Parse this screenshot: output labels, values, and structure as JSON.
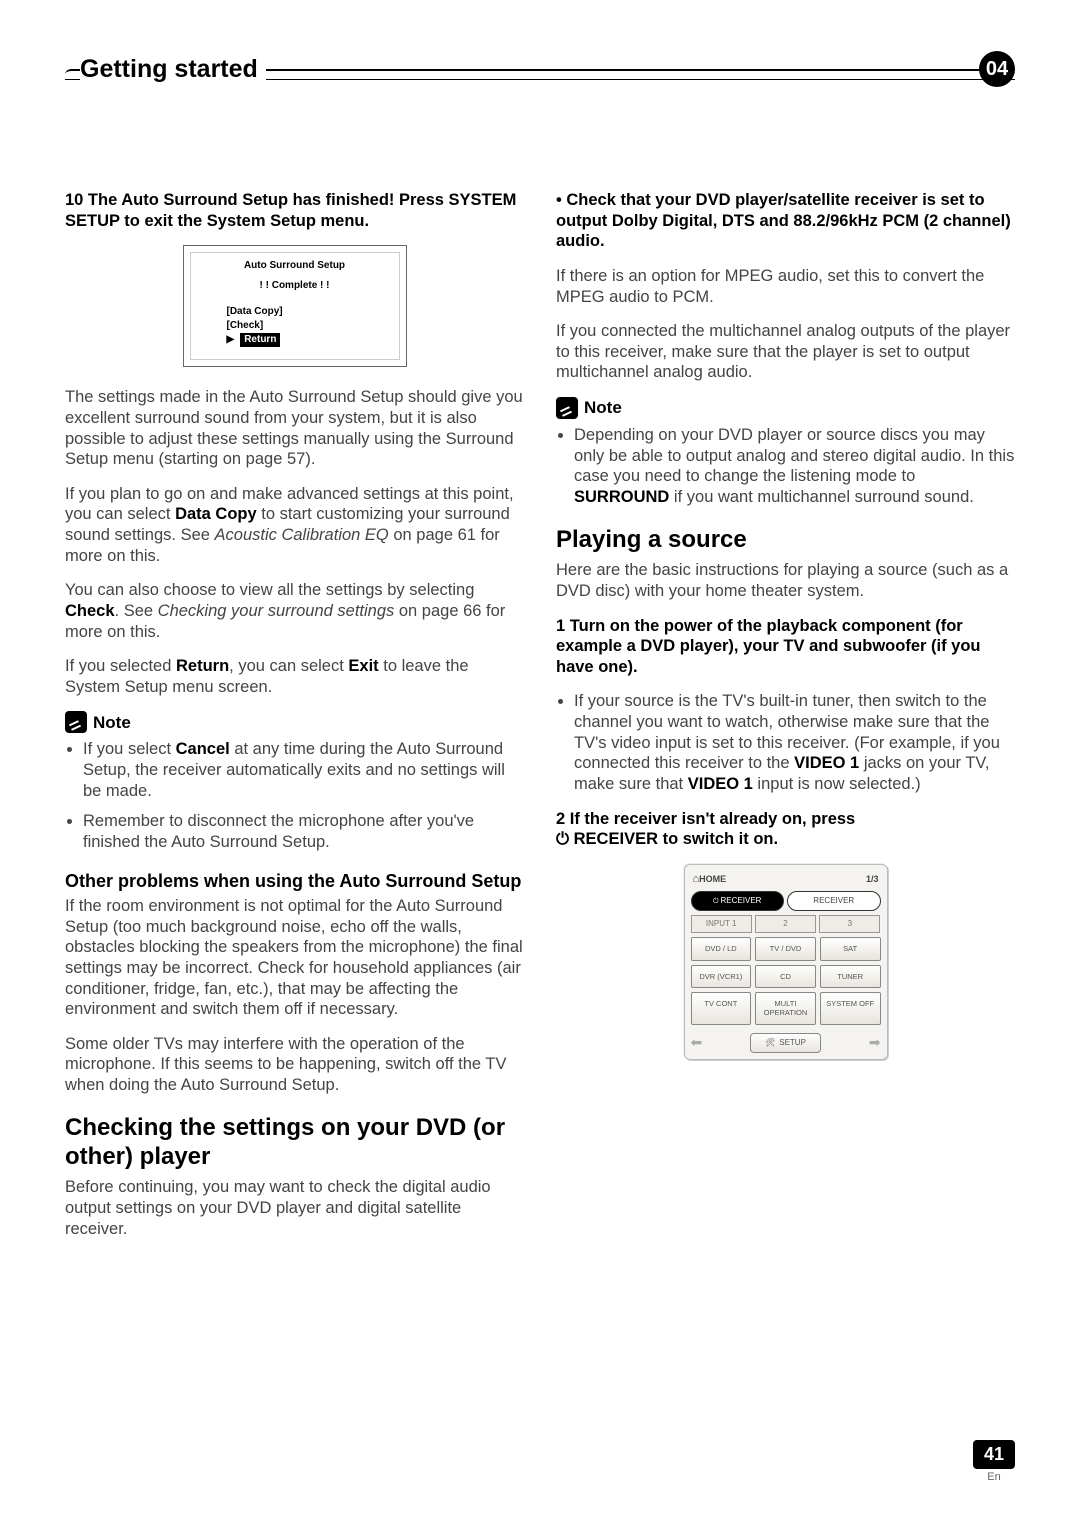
{
  "header": {
    "chapter_title": "Getting started",
    "chapter_number": "04"
  },
  "left": {
    "step10": "10  The Auto Surround Setup has finished! Press SYSTEM SETUP to exit the System Setup menu.",
    "osd": {
      "title": "Auto Surround Setup",
      "status": "! !  Complete  ! !",
      "line1": "[Data Copy]",
      "line2": "[Check]",
      "return": "Return"
    },
    "para1_a": "The settings made in the Auto Surround Setup should give you excellent surround sound from your system, but it is also possible to adjust these settings manually using the Surround Setup menu (starting on page 57).",
    "para2_a": "If you plan to go on and make advanced settings at this point, you can select ",
    "para2_b": "Data Copy",
    "para2_c": " to start customizing your surround sound settings. See ",
    "para2_d": "Acoustic Calibration EQ",
    "para2_e": " on page 61 for more on this.",
    "para3_a": "You can also choose to view all the settings by selecting ",
    "para3_b": "Check",
    "para3_c": ". See ",
    "para3_d": "Checking your surround settings",
    "para3_e": " on page 66 for more on this.",
    "para4_a": "If you selected ",
    "para4_b": "Return",
    "para4_c": ", you can select ",
    "para4_d": "Exit",
    "para4_e": " to leave the System Setup menu screen.",
    "note_label": "Note",
    "note_items": [
      {
        "a": "If you select ",
        "b": "Cancel",
        "c": " at any time during the Auto Surround Setup, the receiver automatically exits and no settings will be made."
      },
      {
        "a": "Remember to disconnect the microphone after you've finished the Auto Surround Setup.",
        "b": "",
        "c": ""
      }
    ],
    "sub1_title": "Other problems when using the Auto Surround Setup",
    "sub1_p1": "If the room environment is not optimal for the Auto Surround Setup (too much background noise, echo off the walls, obstacles blocking the speakers from the microphone) the final settings may be incorrect. Check for household appliances (air conditioner, fridge, fan, etc.), that may be affecting the environment and switch them off if necessary.",
    "sub1_p2": "Some older TVs may interfere with the operation of the microphone. If this seems to be happening, switch off the TV when doing the Auto Surround Setup.",
    "section2_title": "Checking the settings on your DVD (or other) player",
    "section2_p1": "Before continuing, you may want to check the digital audio output settings on your DVD player and digital satellite receiver."
  },
  "right": {
    "bullet1": "Check that your DVD player/satellite receiver is set to output Dolby Digital, DTS and 88.2/96kHz PCM (2 channel) audio.",
    "p1": "If there is an option for MPEG audio, set this to convert the MPEG audio to PCM.",
    "p2": "If you connected the multichannel analog outputs of the player to this receiver, make sure that the player is set to output multichannel analog audio.",
    "note_label": "Note",
    "note1_a": "Depending on your DVD player or source discs you may only be able to output analog and stereo digital audio. In this case you need to change the listening mode to ",
    "note1_b": "SURROUND",
    "note1_c": " if you want multichannel surround sound.",
    "section_title": "Playing a source",
    "section_p1": "Here are the basic instructions for playing a source (such as a DVD disc) with your home theater system.",
    "step1": "1    Turn on the power of the playback component (for example a DVD player), your TV and subwoofer (if you have one).",
    "step1_bullet_a": "If your source is the TV's built-in tuner, then switch to the channel you want to watch, otherwise make sure that the TV's video input is set to this receiver. (For example, if you connected this receiver to the ",
    "step1_bullet_b": "VIDEO 1",
    "step1_bullet_c": " jacks on your TV, make sure that ",
    "step1_bullet_d": "VIDEO 1",
    "step1_bullet_e": " input is now selected.)",
    "step2_a": "2    If the receiver isn't already on, press ",
    "step2_b": "RECEIVER to switch it on.",
    "remote": {
      "home": "HOME",
      "page": "1/3",
      "tab1": "RECEIVER",
      "tab2": "RECEIVER",
      "st1": "INPUT 1",
      "st2": "2",
      "st3": "3",
      "b1": "DVD / LD",
      "b2": "TV / DVD",
      "b3": "SAT",
      "b4": "DVR (VCR1)",
      "b5": "CD",
      "b6": "TUNER",
      "b7": "TV CONT",
      "b8": "MULTI OPERATION",
      "b9": "SYSTEM OFF",
      "setup": "SETUP"
    }
  },
  "footer": {
    "page_number": "41",
    "lang": "En"
  }
}
